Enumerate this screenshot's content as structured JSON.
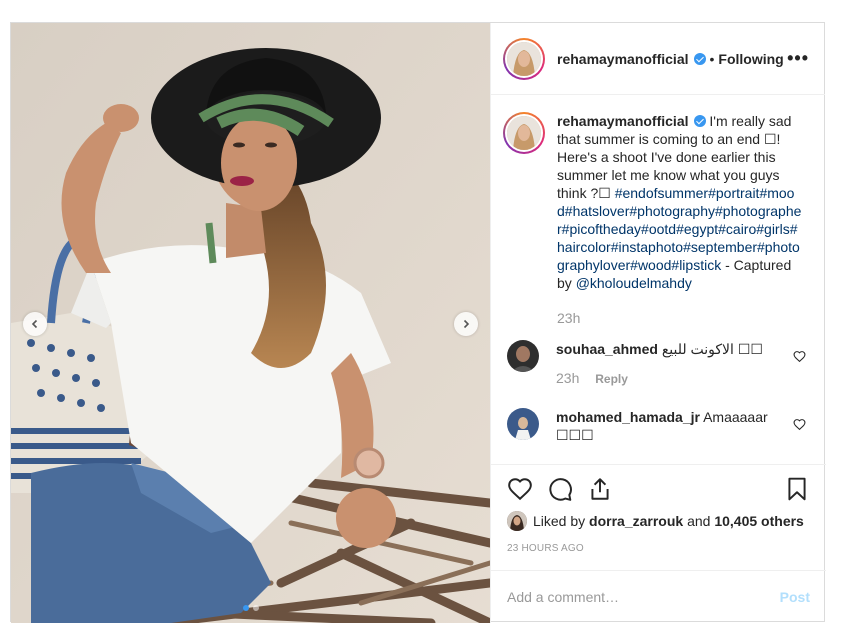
{
  "post": {
    "username": "rehamaymanofficial",
    "bullet": "•",
    "follow_status": "Following",
    "more_label": "•••",
    "caption_text": "I'm really sad that summer is coming to an end ☐! Here's a shoot I've done earlier this summer let me know what you guys think ?☐",
    "caption_hashtags": "#endofsummer#portrait#mood#hatslover#photography#photographer#picoftheday#ootd#egypt#cairo#girls#haircolor#instaphoto#september#photographylover#wood#lipstick",
    "caption_suffix": " - Captured by ",
    "caption_mention": "@kholoudelmahdy",
    "caption_time": "23h",
    "carousel": {
      "slide_count": 2,
      "active_index": 0
    }
  },
  "comments": [
    {
      "username": "souhaa_ahmed",
      "text": "الاكونت للبيع ☐☐",
      "time": "23h",
      "reply_label": "Reply"
    },
    {
      "username": "mohamed_hamada_jr",
      "text": "Amaaaaar ☐☐☐"
    }
  ],
  "likes": {
    "prefix": "Liked by ",
    "liker": "dorra_zarrouk",
    "connector": " and ",
    "others": "10,405 others"
  },
  "timestamp": "23 HOURS AGO",
  "add_comment": {
    "placeholder": "Add a comment…",
    "post_label": "Post"
  },
  "colors": {
    "verified": "#3897f0",
    "link": "#003569",
    "post_disabled": "#b2dffc"
  },
  "icons": [
    "verified-badge-icon",
    "more-options-icon",
    "heart-icon",
    "comment-icon",
    "share-icon",
    "bookmark-icon",
    "chevron-left-icon",
    "chevron-right-icon"
  ]
}
